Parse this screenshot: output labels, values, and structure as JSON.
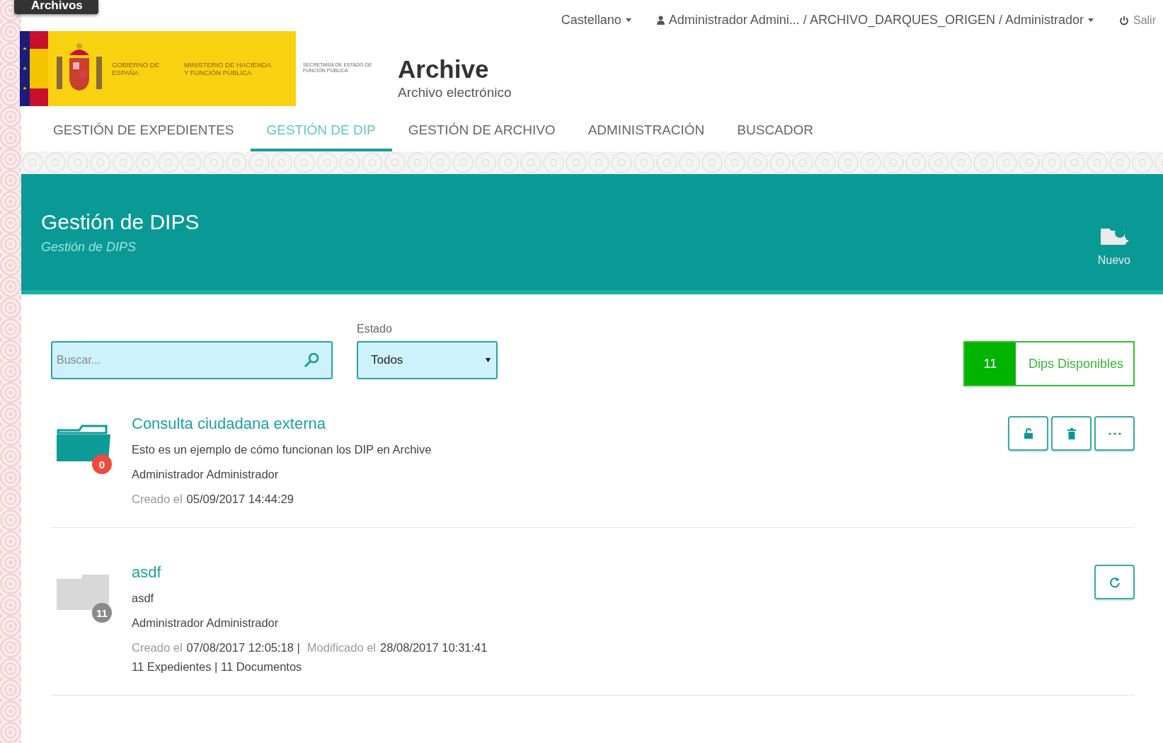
{
  "corner_tab": "Archivos",
  "topbar": {
    "language": "Castellano",
    "user": "Administrador Admini... / ARCHIVO_DARQUES_ORIGEN / Administrador",
    "logout": "Salir"
  },
  "logo": {
    "government": "GOBIERNO DE ESPAÑA",
    "ministry": "MINISTERIO DE HACIENDA Y FUNCIÓN PÚBLICA",
    "secretariat": "SECRETARÍA DE ESTADO DE FUNCIÓN PÚBLICA"
  },
  "app": {
    "title": "Archive",
    "subtitle": "Archivo electrónico"
  },
  "tabs": [
    {
      "label": "GESTIÓN DE EXPEDIENTES",
      "selected": false
    },
    {
      "label": "GESTIÓN DE DIP",
      "selected": true
    },
    {
      "label": "GESTIÓN DE ARCHIVO",
      "selected": false
    },
    {
      "label": "ADMINISTRACIÓN",
      "selected": false
    },
    {
      "label": "BUSCADOR",
      "selected": false
    }
  ],
  "banner": {
    "title": "Gestión de DIPS",
    "subtitle": "Gestión de DIPS",
    "new_button": "Nuevo"
  },
  "filters": {
    "search": {
      "placeholder": "Buscar..."
    },
    "estado": {
      "label": "Estado",
      "value": "Todos"
    }
  },
  "available": {
    "count": "11",
    "label": "Dips Disponibles"
  },
  "dips": [
    {
      "kind": "active",
      "title": "Consulta ciudadana externa",
      "badge": "0",
      "description": "Esto es un ejemplo de cómo funcionan los DIP en Archive",
      "author": "Administrador Administrador",
      "meta": [
        {
          "label": "Creado el",
          "value": "05/09/2017 14:44:29"
        }
      ],
      "actions": [
        {
          "kind": "unlock"
        },
        {
          "kind": "delete"
        },
        {
          "kind": "more"
        }
      ]
    },
    {
      "kind": "inactive",
      "title": "asdf",
      "badge": "11",
      "description": "asdf",
      "author": "Administrador Administrador",
      "meta": [
        {
          "label": "Creado el",
          "value": "07/08/2017 12:05:18",
          "separator": "|"
        },
        {
          "label": "Modificado el",
          "value": "28/08/2017 10:31:41"
        }
      ],
      "counts": "11 Expedientes | 11 Documentos",
      "actions": [
        {
          "kind": "refresh"
        }
      ]
    }
  ]
}
